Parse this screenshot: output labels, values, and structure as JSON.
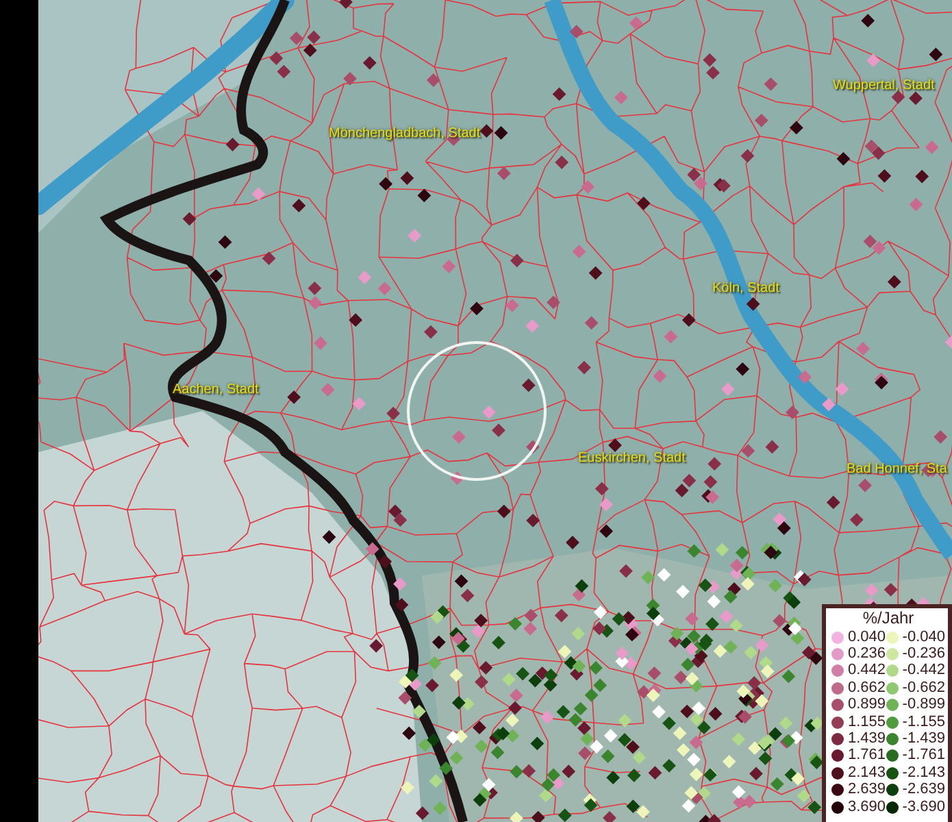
{
  "map": {
    "place_labels": [
      {
        "text": "Mönchengladbach, Stadt"
      },
      {
        "text": "Wuppertal, Stadt"
      },
      {
        "text": "Köln, Stadt"
      },
      {
        "text": "Aachen, Stadt"
      },
      {
        "text": "Euskirchen, Stadt"
      },
      {
        "text": "Bad Honnef, Sta"
      }
    ]
  },
  "legend": {
    "title": "%/Jahr",
    "positive": [
      {
        "value": "0.040",
        "color": "#f2b3e3"
      },
      {
        "value": "0.236",
        "color": "#e49ac8"
      },
      {
        "value": "0.442",
        "color": "#d17fa6"
      },
      {
        "value": "0.662",
        "color": "#bf6a8a"
      },
      {
        "value": "0.899",
        "color": "#a84e6a"
      },
      {
        "value": "1.155",
        "color": "#943d55"
      },
      {
        "value": "1.439",
        "color": "#7d2a40"
      },
      {
        "value": "1.761",
        "color": "#6a1a2e"
      },
      {
        "value": "2.143",
        "color": "#4f0e1c"
      },
      {
        "value": "2.639",
        "color": "#3a0712"
      },
      {
        "value": "3.690",
        "color": "#230308"
      }
    ],
    "negative": [
      {
        "value": "-0.040",
        "color": "#eef5b8"
      },
      {
        "value": "-0.236",
        "color": "#cde6a0"
      },
      {
        "value": "-0.442",
        "color": "#b0d98a"
      },
      {
        "value": "-0.662",
        "color": "#8fc870"
      },
      {
        "value": "-0.899",
        "color": "#6fb356"
      },
      {
        "value": "-1.155",
        "color": "#4f9c3e"
      },
      {
        "value": "-1.439",
        "color": "#3a852e"
      },
      {
        "value": "-1.761",
        "color": "#276c20"
      },
      {
        "value": "-2.143",
        "color": "#175414"
      },
      {
        "value": "-2.639",
        "color": "#0c3f0c"
      },
      {
        "value": "-3.690",
        "color": "#062806"
      }
    ]
  }
}
